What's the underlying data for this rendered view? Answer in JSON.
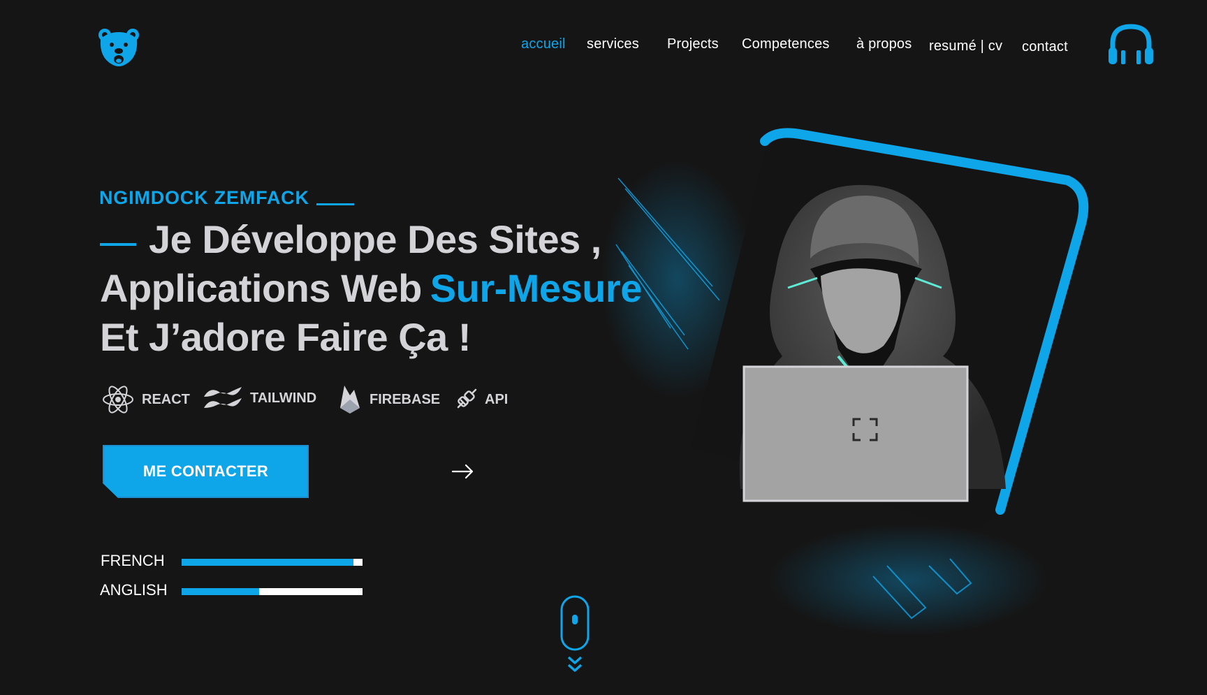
{
  "brand": {
    "logo_icon": "bear-face-icon",
    "accent_color": "#0ea5e9",
    "background_color": "#151515"
  },
  "nav": {
    "items": [
      {
        "label": "accueil",
        "active": true
      },
      {
        "label": "services",
        "active": false
      },
      {
        "label": "Projects",
        "active": false
      },
      {
        "label": "Competences",
        "active": false
      },
      {
        "label": "à propos",
        "active": false
      },
      {
        "label": "resumé | cv",
        "active": false
      },
      {
        "label": "contact",
        "active": false
      }
    ],
    "audio_icon": "headphones-icon"
  },
  "hero": {
    "eyebrow": "NGIMDOCK ZEMFACK",
    "headline_line1": "Je Développe Des Sites ,",
    "headline_line2": "Applications Web",
    "headline_accent": "Sur-Mesure",
    "headline_line3": "Et J’adore Faire Ça !",
    "tech_stack": [
      {
        "label": "REACT",
        "icon": "react-atom-icon"
      },
      {
        "label": "TAILWIND",
        "icon": "tailwind-wave-icon"
      },
      {
        "label": "FIREBASE",
        "icon": "firebase-flame-icon"
      },
      {
        "label": "API",
        "icon": "plug-link-icon"
      }
    ],
    "cta_label": "ME CONTACTER",
    "cta_arrow_icon": "arrow-right-icon"
  },
  "languages": [
    {
      "label": "FRENCH",
      "level": 0.95
    },
    {
      "label": "ANGLISH",
      "level": 0.43
    }
  ],
  "scroll_indicator": {
    "icon": "mouse-scroll-icon",
    "chevron_icon": "double-chevron-down-icon"
  },
  "illustration": {
    "subject": "hooded-hacker-with-laptop",
    "frame_color": "#0ea5e9"
  }
}
